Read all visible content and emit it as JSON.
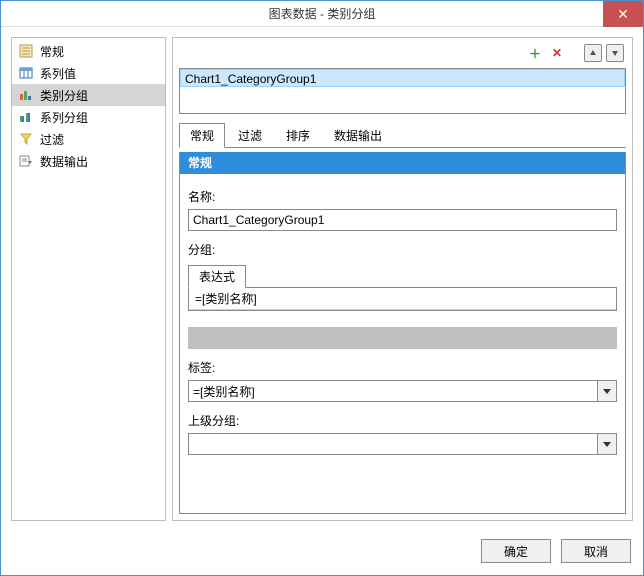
{
  "title": "图表数据 - 类别分组",
  "close_label": "✕",
  "sidebar": {
    "items": [
      {
        "label": "常规",
        "icon": "properties-icon"
      },
      {
        "label": "系列值",
        "icon": "series-data-icon"
      },
      {
        "label": "类别分组",
        "icon": "category-group-icon"
      },
      {
        "label": "系列分组",
        "icon": "series-group-icon"
      },
      {
        "label": "过滤",
        "icon": "filter-icon"
      },
      {
        "label": "数据输出",
        "icon": "data-output-icon"
      }
    ],
    "selected_index": 2
  },
  "main": {
    "list": [
      "Chart1_CategoryGroup1"
    ],
    "tabs": [
      "常规",
      "过滤",
      "排序",
      "数据输出"
    ],
    "active_tab_index": 0,
    "panel": {
      "section_title": "常规",
      "name_label": "名称:",
      "name_value": "Chart1_CategoryGroup1",
      "group_label": "分组:",
      "group_sub_tab": "表达式",
      "group_expression": "=[类别名称]",
      "label_label": "标签:",
      "label_value": "=[类别名称]",
      "parent_label": "上级分组:",
      "parent_value": ""
    }
  },
  "footer": {
    "ok": "确定",
    "cancel": "取消"
  },
  "icons": {
    "add": "＋",
    "delete": "✕"
  }
}
